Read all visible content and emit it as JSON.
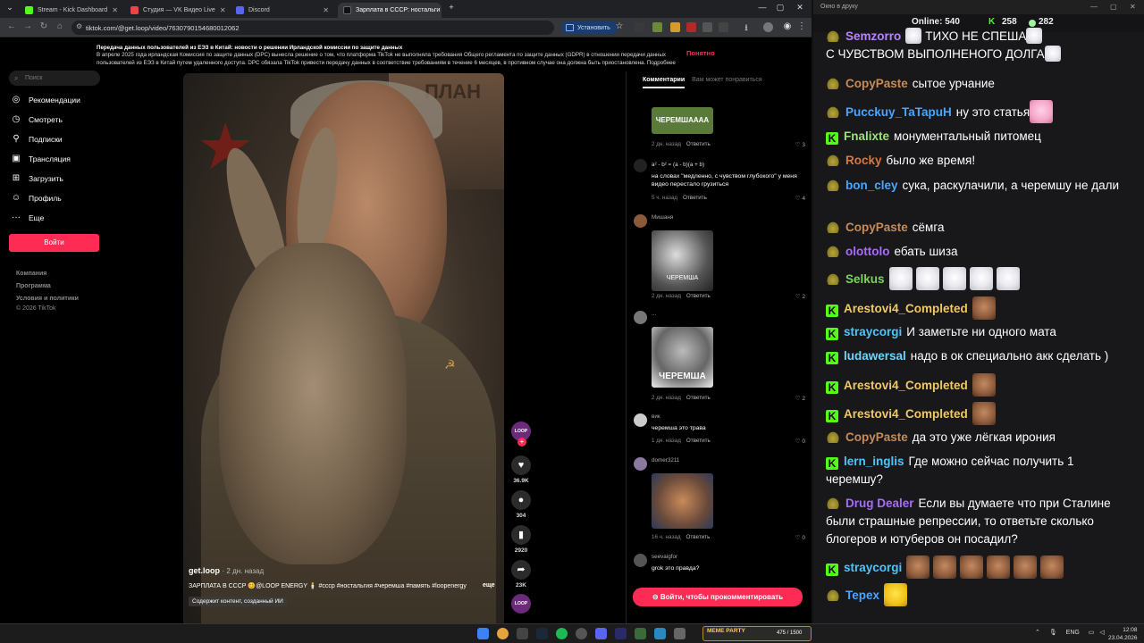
{
  "browser": {
    "tabs": [
      {
        "title": "Stream - Kick Dashboard",
        "color": "#53fc18"
      },
      {
        "title": "Студия — VK Видео Live",
        "color": "#e64646"
      },
      {
        "title": "Discord",
        "color": "#5865f2"
      },
      {
        "title": "Зарплата в СССР: ностальги",
        "color": "#111111"
      }
    ],
    "url": "tiktok.com/@get.loop/video/7630790154680012062",
    "install_label": "Установить"
  },
  "tiktok": {
    "privacy_title": "Передача данных пользователей из ЕЭЗ в Китай: новости о решении Ирландской комиссии по защите данных",
    "privacy_line1": "В апреле 2025 года ирландская Комиссия по защите данных (DPC) вынесла решение о том, что платформа TikTok не выполняла требования Общего регламента по защите данных (GDPR) в отношении передачи данных",
    "privacy_line2": "пользователей из ЕЭЗ в Китай путем удаленного доступа. DPC обязала TikTok привести передачу данных в соответствие требованиям в течение 6 месяцев, в противном случае она должна быть приостановлена. Подробнее",
    "privacy_accept": "Понятно",
    "search_placeholder": "Поиск",
    "nav": [
      "Рекомендации",
      "Смотреть",
      "Подписки",
      "Трансляция",
      "Загрузить",
      "Профиль",
      "Еще"
    ],
    "login_label": "Войти",
    "footer": [
      "Компания",
      "Программа",
      "Условия и политики",
      "© 2026 TikTok"
    ],
    "video": {
      "author": "get.loop",
      "age": "· 2 дн. назад",
      "caption": "ЗАРПЛАТА В СССР 😊@LOOP ENERGY 🕯️ #ссср #ностальгия #черемша #память #loopenergy",
      "more": "еще",
      "ai_label": "Содержит контент, созданный ИИ",
      "poster_text": "ПЛАН",
      "progress": 0.1,
      "likes": "36.9K",
      "comments": "304",
      "saves": "2920",
      "shares": "23K",
      "avatar_text": "LOOP"
    },
    "comments_tabs": [
      "Комментарии",
      "Вам может понравиться"
    ],
    "comments": [
      {
        "name": "",
        "text": "",
        "img_text": "ЧЕРЕМШАААА",
        "meta": "2 дн. назад",
        "reply": "Ответить",
        "likes": "3"
      },
      {
        "name": "",
        "text": "a² - b² = (a - b)(a + b)",
        "text2": "на словах \"медленно, с чувством глубокого\" у меня видео перестало грузиться",
        "meta": "5 ч. назад",
        "reply": "Ответить",
        "likes": "4"
      },
      {
        "name": "Мишаня",
        "img_text": "ЧЕРЕМША",
        "meta": "2 дн. назад",
        "reply": "Ответить",
        "likes": "2"
      },
      {
        "name": "...",
        "img_text": "ЧЕРЕМША",
        "meta": "2 дн. назад",
        "reply": "Ответить",
        "likes": "2"
      },
      {
        "name": "вик",
        "text": "черемша это трава",
        "meta": "1 дн. назад",
        "reply": "Ответить",
        "likes": "0"
      },
      {
        "name": "domer3211",
        "img_text": "",
        "meta": "16 ч. назад",
        "reply": "Ответить",
        "likes": "0"
      },
      {
        "name": "seevaigfor",
        "text": "grok это правда?",
        "meta": "",
        "reply": "",
        "likes": ""
      }
    ],
    "login_comment": "Войти, чтобы прокомментировать"
  },
  "chat": {
    "title": "Окно в друку",
    "online_label": "Online:",
    "online": "540",
    "kick_count": "258",
    "dot_count": "282",
    "messages": [
      {
        "user": "Semzorro",
        "color": "#b783ff",
        "text": "ТИХО НЕ СПЕША",
        "text2": "С ЧУВСТВОМ ВЫПОЛНЕНОГО ДОЛГА",
        "badge": "bowl"
      },
      {
        "user": "CopyPaste",
        "color": "#c78b57",
        "text": "сытое урчание",
        "badge": "bowl"
      },
      {
        "user": "Pucckuy_TaTapuH",
        "color": "#4aa5ff",
        "text": "ну это статья",
        "badge": "bowl"
      },
      {
        "user": "Fnalixte",
        "color": "#9be27a",
        "text": "монументальный питомец",
        "badge": "k"
      },
      {
        "user": "Rocky",
        "color": "#d8783c",
        "text": "было же время!",
        "badge": "bowl"
      },
      {
        "user": "bon_cley",
        "color": "#4aa5ff",
        "text": "сука, раскулачили, а черемшу не дали",
        "badge": "bowl"
      },
      {
        "user": "CopyPaste",
        "color": "#c78b57",
        "text": "сёмга",
        "badge": "bowl"
      },
      {
        "user": "olottolo",
        "color": "#a86bff",
        "text": "ебать шиза",
        "badge": "bowl"
      },
      {
        "user": "Selkus",
        "color": "#7bd35a",
        "text": "",
        "badge": "bowl"
      },
      {
        "user": "Arestovi4_Completed",
        "color": "#f0c864",
        "text": "",
        "badge": "k"
      },
      {
        "user": "straycorgi",
        "color": "#4ac6ff",
        "text": "И заметьте ни одного мата",
        "badge": "k"
      },
      {
        "user": "ludawersal",
        "color": "#6ad6ff",
        "text": "надо в ок специально акк сделать )",
        "badge": "k"
      },
      {
        "user": "Arestovi4_Completed",
        "color": "#f0c864",
        "text": "",
        "badge": "k"
      },
      {
        "user": "Arestovi4_Completed",
        "color": "#f0c864",
        "text": "",
        "badge": "k"
      },
      {
        "user": "CopyPaste",
        "color": "#c78b57",
        "text": "да это уже лёгкая ирония",
        "badge": "bowl"
      },
      {
        "user": "lern_inglis",
        "color": "#4ac6ff",
        "text": "Где можно сейчас получить 1 черемшу?",
        "badge": "k"
      },
      {
        "user": "Drug Dealer",
        "color": "#a86bff",
        "text": "Если вы думаете что при Сталине были страшные репрессии, то ответьте сколько блогеров и ютуберов он посадил?",
        "badge": "bowl"
      },
      {
        "user": "straycorgi",
        "color": "#4ac6ff",
        "text": "",
        "badge": "k"
      },
      {
        "user": "Tepex",
        "color": "#4aa5ff",
        "text": "",
        "badge": "bowl"
      }
    ]
  },
  "taskbar": {
    "game_label": "MEME PARTY",
    "game_count": "475 / 1500",
    "lang": "ENG",
    "time": "12:08",
    "date": "23.04.2026"
  }
}
